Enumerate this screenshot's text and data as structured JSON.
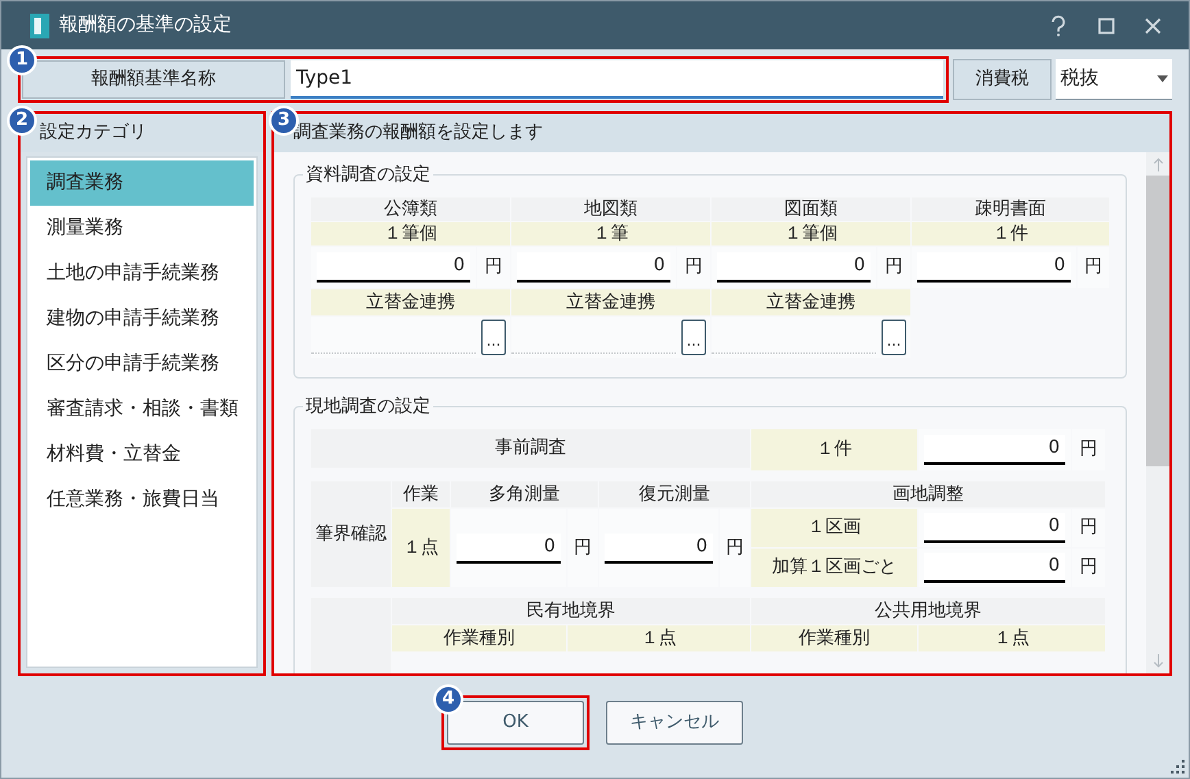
{
  "window": {
    "title": "報酬額の基準の設定"
  },
  "name_field": {
    "callout": "1",
    "label": "報酬額基準名称",
    "value": "Type1"
  },
  "tax": {
    "label": "消費税",
    "value": "税抜"
  },
  "categories": {
    "callout": "2",
    "title": "設定カテゴリ",
    "items": [
      {
        "label": "調査業務",
        "selected": true
      },
      {
        "label": "測量業務",
        "selected": false
      },
      {
        "label": "土地の申請手続業務",
        "selected": false
      },
      {
        "label": "建物の申請手続業務",
        "selected": false
      },
      {
        "label": "区分の申請手続業務",
        "selected": false
      },
      {
        "label": "審査請求・相談・書類",
        "selected": false
      },
      {
        "label": "材料費・立替金",
        "selected": false
      },
      {
        "label": "任意業務・旅費日当",
        "selected": false
      }
    ]
  },
  "detail": {
    "callout": "3",
    "title": "調査業務の報酬額を設定します",
    "document_survey": {
      "title": "資料調査の設定",
      "items": [
        {
          "name": "公簿類",
          "unit": "１筆個",
          "value": "0",
          "currency": "円"
        },
        {
          "name": "地図類",
          "unit": "１筆",
          "value": "0",
          "currency": "円"
        },
        {
          "name": "図面類",
          "unit": "１筆個",
          "value": "0",
          "currency": "円"
        },
        {
          "name": "疎明書面",
          "unit": "１件",
          "value": "0",
          "currency": "円"
        }
      ],
      "links": [
        {
          "label": "立替金連携",
          "button": "..."
        },
        {
          "label": "立替金連携",
          "button": "..."
        },
        {
          "label": "立替金連携",
          "button": "..."
        }
      ]
    },
    "field_survey": {
      "title": "現地調査の設定",
      "prior": {
        "name": "事前調査",
        "unit": "１件",
        "value": "0",
        "currency": "円"
      },
      "boundary": {
        "label": "筆界確認",
        "work_header": "作業",
        "work_unit": "１点",
        "polygon": {
          "name": "多角測量",
          "value": "0",
          "currency": "円"
        },
        "restoration": {
          "name": "復元測量",
          "value": "0",
          "currency": "円"
        },
        "adjustment": {
          "name": "画地調整",
          "rows": [
            {
              "unit": "１区画",
              "value": "0",
              "currency": "円"
            },
            {
              "unit": "加算１区画ごと",
              "value": "0",
              "currency": "円"
            }
          ]
        }
      },
      "borders": [
        {
          "name": "民有地境界",
          "type_header": "作業種別",
          "unit": "１点"
        },
        {
          "name": "公共用地境界",
          "type_header": "作業種別",
          "unit": "１点"
        }
      ]
    }
  },
  "buttons": [
    {
      "label": "OK",
      "callout": "4"
    },
    {
      "label": "キャンセル"
    }
  ]
}
